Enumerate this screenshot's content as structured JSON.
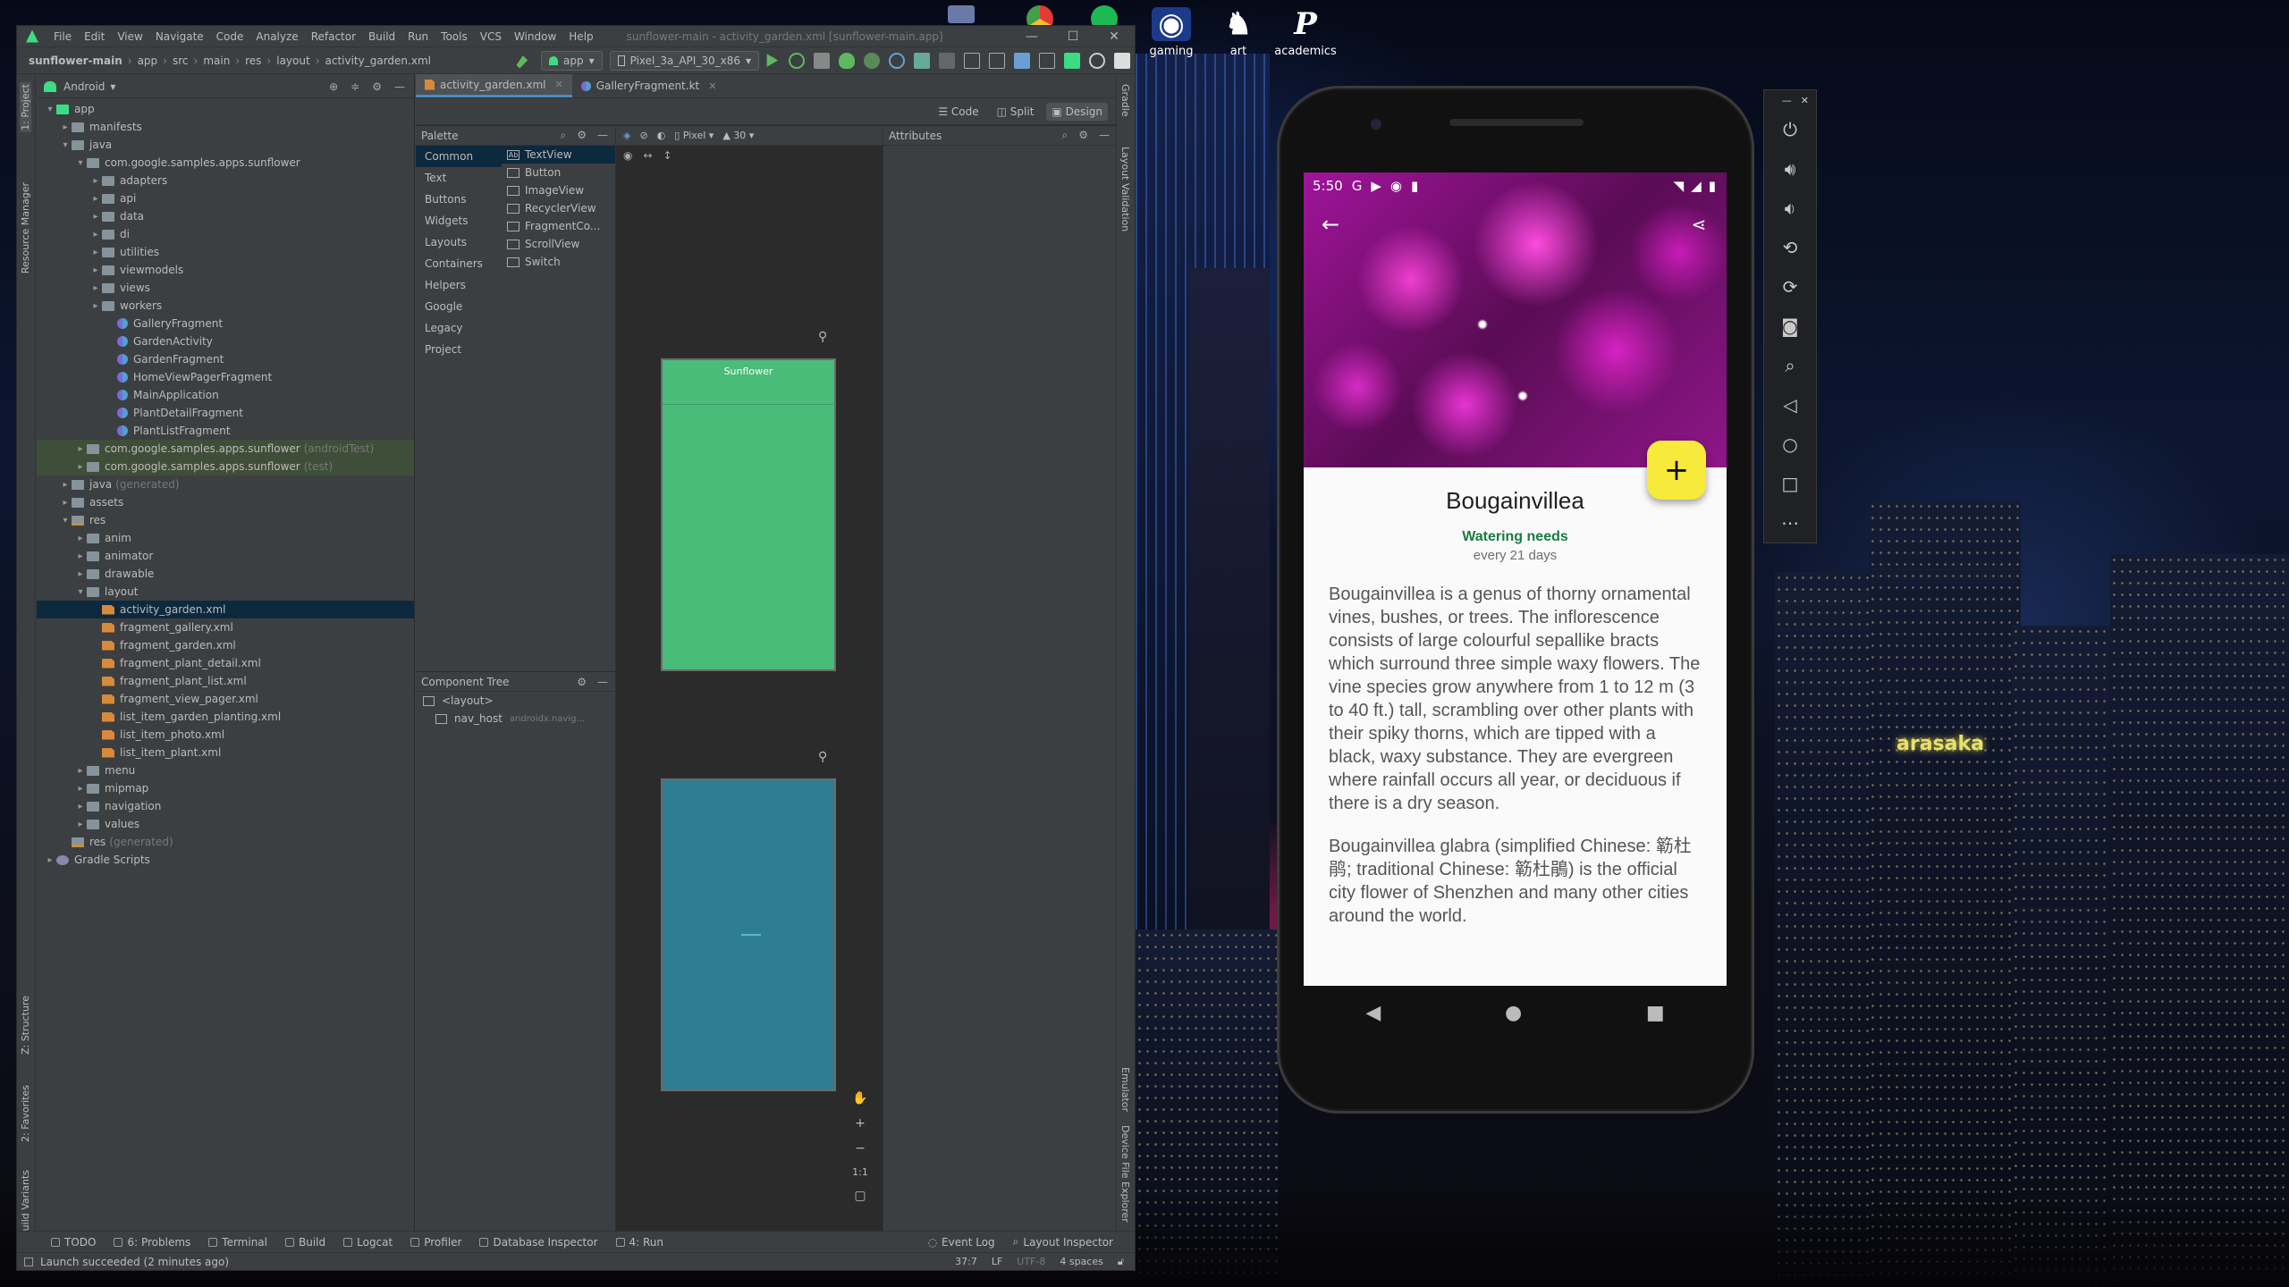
{
  "desktop": {
    "icons": [
      {
        "label": "gaming"
      },
      {
        "label": "art"
      },
      {
        "label": "academics"
      }
    ]
  },
  "ide": {
    "menu": [
      "File",
      "Edit",
      "View",
      "Navigate",
      "Code",
      "Analyze",
      "Refactor",
      "Build",
      "Run",
      "Tools",
      "VCS",
      "Window",
      "Help"
    ],
    "title": "sunflower-main - activity_garden.xml [sunflower-main.app]",
    "breadcrumbs": [
      "sunflower-main",
      "app",
      "src",
      "main",
      "res",
      "layout",
      "activity_garden.xml"
    ],
    "run_config": "app",
    "device": "Pixel_3a_API_30_x86",
    "left_tools": [
      "1: Project",
      "Resource Manager",
      "Z: Structure",
      "2: Favorites",
      "Build Variants"
    ],
    "right_tools": [
      "Gradle",
      "Layout Validation",
      "Emulator",
      "Device File Explorer"
    ],
    "project_view": "Android",
    "tree": [
      {
        "label": "app",
        "depth": 0,
        "arrow": "▾",
        "icon": "mod"
      },
      {
        "label": "manifests",
        "depth": 1,
        "arrow": "▸",
        "icon": "folder"
      },
      {
        "label": "java",
        "depth": 1,
        "arrow": "▾",
        "icon": "folder"
      },
      {
        "label": "com.google.samples.apps.sunflower",
        "depth": 2,
        "arrow": "▾",
        "icon": "pkg"
      },
      {
        "label": "adapters",
        "depth": 3,
        "arrow": "▸",
        "icon": "pkg"
      },
      {
        "label": "api",
        "depth": 3,
        "arrow": "▸",
        "icon": "pkg"
      },
      {
        "label": "data",
        "depth": 3,
        "arrow": "▸",
        "icon": "pkg"
      },
      {
        "label": "di",
        "depth": 3,
        "arrow": "▸",
        "icon": "pkg"
      },
      {
        "label": "utilities",
        "depth": 3,
        "arrow": "▸",
        "icon": "pkg"
      },
      {
        "label": "viewmodels",
        "depth": 3,
        "arrow": "▸",
        "icon": "pkg"
      },
      {
        "label": "views",
        "depth": 3,
        "arrow": "▸",
        "icon": "pkg"
      },
      {
        "label": "workers",
        "depth": 3,
        "arrow": "▸",
        "icon": "pkg"
      },
      {
        "label": "GalleryFragment",
        "depth": 4,
        "arrow": "",
        "icon": "kt"
      },
      {
        "label": "GardenActivity",
        "depth": 4,
        "arrow": "",
        "icon": "kt"
      },
      {
        "label": "GardenFragment",
        "depth": 4,
        "arrow": "",
        "icon": "kt"
      },
      {
        "label": "HomeViewPagerFragment",
        "depth": 4,
        "arrow": "",
        "icon": "kt"
      },
      {
        "label": "MainApplication",
        "depth": 4,
        "arrow": "",
        "icon": "kt"
      },
      {
        "label": "PlantDetailFragment",
        "depth": 4,
        "arrow": "",
        "icon": "kt"
      },
      {
        "label": "PlantListFragment",
        "depth": 4,
        "arrow": "",
        "icon": "kt"
      },
      {
        "label": "com.google.samples.apps.sunflower",
        "suffix": "(androidTest)",
        "depth": 2,
        "arrow": "▸",
        "icon": "pkg",
        "hl": true
      },
      {
        "label": "com.google.samples.apps.sunflower",
        "suffix": "(test)",
        "depth": 2,
        "arrow": "▸",
        "icon": "pkg",
        "hl": true
      },
      {
        "label": "java",
        "suffix": "(generated)",
        "depth": 1,
        "arrow": "▸",
        "icon": "folder"
      },
      {
        "label": "assets",
        "depth": 1,
        "arrow": "▸",
        "icon": "folder"
      },
      {
        "label": "res",
        "depth": 1,
        "arrow": "▾",
        "icon": "res"
      },
      {
        "label": "anim",
        "depth": 2,
        "arrow": "▸",
        "icon": "folder"
      },
      {
        "label": "animator",
        "depth": 2,
        "arrow": "▸",
        "icon": "folder"
      },
      {
        "label": "drawable",
        "depth": 2,
        "arrow": "▸",
        "icon": "folder"
      },
      {
        "label": "layout",
        "depth": 2,
        "arrow": "▾",
        "icon": "folder"
      },
      {
        "label": "activity_garden.xml",
        "depth": 3,
        "arrow": "",
        "icon": "xml",
        "sel": true
      },
      {
        "label": "fragment_gallery.xml",
        "depth": 3,
        "arrow": "",
        "icon": "xml"
      },
      {
        "label": "fragment_garden.xml",
        "depth": 3,
        "arrow": "",
        "icon": "xml"
      },
      {
        "label": "fragment_plant_detail.xml",
        "depth": 3,
        "arrow": "",
        "icon": "xml"
      },
      {
        "label": "fragment_plant_list.xml",
        "depth": 3,
        "arrow": "",
        "icon": "xml"
      },
      {
        "label": "fragment_view_pager.xml",
        "depth": 3,
        "arrow": "",
        "icon": "xml"
      },
      {
        "label": "list_item_garden_planting.xml",
        "depth": 3,
        "arrow": "",
        "icon": "xml"
      },
      {
        "label": "list_item_photo.xml",
        "depth": 3,
        "arrow": "",
        "icon": "xml"
      },
      {
        "label": "list_item_plant.xml",
        "depth": 3,
        "arrow": "",
        "icon": "xml"
      },
      {
        "label": "menu",
        "depth": 2,
        "arrow": "▸",
        "icon": "folder"
      },
      {
        "label": "mipmap",
        "depth": 2,
        "arrow": "▸",
        "icon": "folder"
      },
      {
        "label": "navigation",
        "depth": 2,
        "arrow": "▸",
        "icon": "folder"
      },
      {
        "label": "values",
        "depth": 2,
        "arrow": "▸",
        "icon": "folder"
      },
      {
        "label": "res",
        "suffix": "(generated)",
        "depth": 1,
        "arrow": "",
        "icon": "res"
      },
      {
        "label": "Gradle Scripts",
        "depth": 0,
        "arrow": "▸",
        "icon": "grd"
      }
    ],
    "tabs": [
      "activity_garden.xml",
      "GalleryFragment.kt"
    ],
    "modes": [
      "Code",
      "Split",
      "Design"
    ],
    "palette": {
      "title": "Palette",
      "categories": [
        "Common",
        "Text",
        "Buttons",
        "Widgets",
        "Layouts",
        "Containers",
        "Helpers",
        "Google",
        "Legacy",
        "Project"
      ],
      "widgets": [
        {
          "icon": "Ab",
          "label": "TextView"
        },
        {
          "icon": "",
          "label": "Button"
        },
        {
          "icon": "",
          "label": "ImageView"
        },
        {
          "icon": "",
          "label": "RecyclerView"
        },
        {
          "icon": "",
          "label": "FragmentCo..."
        },
        {
          "icon": "",
          "label": "ScrollView"
        },
        {
          "icon": "",
          "label": "Switch"
        }
      ]
    },
    "design_toolbar": {
      "device": "Pixel",
      "api": "30"
    },
    "preview_title": "Sunflower",
    "attributes_title": "Attributes",
    "component_tree": {
      "title": "Component Tree",
      "items": [
        {
          "label": "<layout>",
          "extra": ""
        },
        {
          "label": "nav_host",
          "extra": "androidx.navig..."
        }
      ]
    },
    "zoom": "1:1",
    "bottom_tools": [
      "TODO",
      "6: Problems",
      "Terminal",
      "Build",
      "Logcat",
      "Profiler",
      "Database Inspector",
      "4: Run"
    ],
    "bottom_right": [
      "Event Log",
      "Layout Inspector"
    ],
    "status": {
      "message": "Launch succeeded (2 minutes ago)",
      "position": "37:7",
      "line_sep": "LF",
      "encoding": "UTF-8",
      "indent": "4 spaces"
    }
  },
  "phone": {
    "time": "5:50",
    "plant_name": "Bougainvillea",
    "watering_label": "Watering needs",
    "watering_value": "every 21 days",
    "description_1": "Bougainvillea is a genus of thorny ornamental vines, bushes, or trees. The inflorescence consists of large colourful sepallike bracts which surround three simple waxy flowers. The vine species grow anywhere from 1 to 12 m (3 to 40 ft.) tall, scrambling over other plants with their spiky thorns, which are tipped with a black, waxy substance. They are evergreen where rainfall occurs all year, or deciduous if there is a dry season.",
    "description_2": "Bougainvillea glabra (simplified Chinese: 簕杜鹃; traditional Chinese: 簕杜鵑) is the official city flower of Shenzhen and many other cities around the world.",
    "fab": "+"
  },
  "colors": {
    "accent": "#4a88c7",
    "fab": "#f7ea3a",
    "watering": "#197b45",
    "preview_green": "#49bc7a",
    "preview_blue": "#2f7d92"
  }
}
